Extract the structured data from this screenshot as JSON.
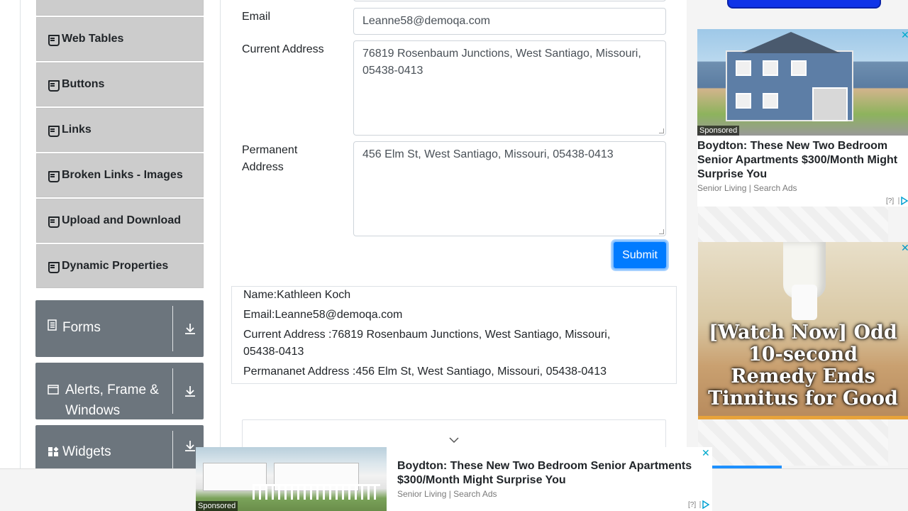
{
  "nav": {
    "items": [
      {
        "label": "Web Tables"
      },
      {
        "label": "Buttons"
      },
      {
        "label": "Links"
      },
      {
        "label": "Broken Links - Images"
      },
      {
        "label": "Upload and Download"
      },
      {
        "label": "Dynamic Properties"
      }
    ],
    "groups": [
      {
        "label": "Forms"
      },
      {
        "label": "Alerts, Frame & Windows"
      },
      {
        "label": "Widgets"
      }
    ]
  },
  "form": {
    "email_label": "Email",
    "email_value": "Leanne58@demoqa.com",
    "current_address_label": "Current Address",
    "current_address_value": "76819 Rosenbaum Junctions, West Santiago, Missouri, 05438-0413",
    "permanent_address_label": "Permanent Address",
    "permanent_address_value": "456 Elm St, West Santiago, Missouri, 05438-0413",
    "submit_label": "Submit"
  },
  "output": {
    "name": "Name:Kathleen Koch",
    "email": "Email:Leanne58@demoqa.com",
    "current_address": "Current Address :76819 Rosenbaum Junctions, West Santiago, Missouri, 05438-0413",
    "permanent_address": "Permananet Address :456 Elm St, West Santiago, Missouri, 05438-0413"
  },
  "ads": {
    "right_top": {
      "title": "Boydton: These New Two Bedroom Senior Apartments $300/Month Might Surprise You",
      "source": "Senior Living | Search Ads",
      "sponsored": "Sponsored",
      "help": "[?]"
    },
    "right_video": {
      "title": "[Watch Now] Odd 10-second Remedy Ends Tinnitus for Good"
    },
    "bottom": {
      "title": "Boydton: These New Two Bedroom Senior Apartments $300/Month Might Surprise You",
      "source": "Senior Living | Search Ads",
      "sponsored": "Sponsored",
      "help": "[?]"
    },
    "close_glyph": "✕"
  },
  "colors": {
    "accent": "#007bff",
    "nav_item_bg": "#cccccc",
    "group_bg": "#6c757d"
  }
}
